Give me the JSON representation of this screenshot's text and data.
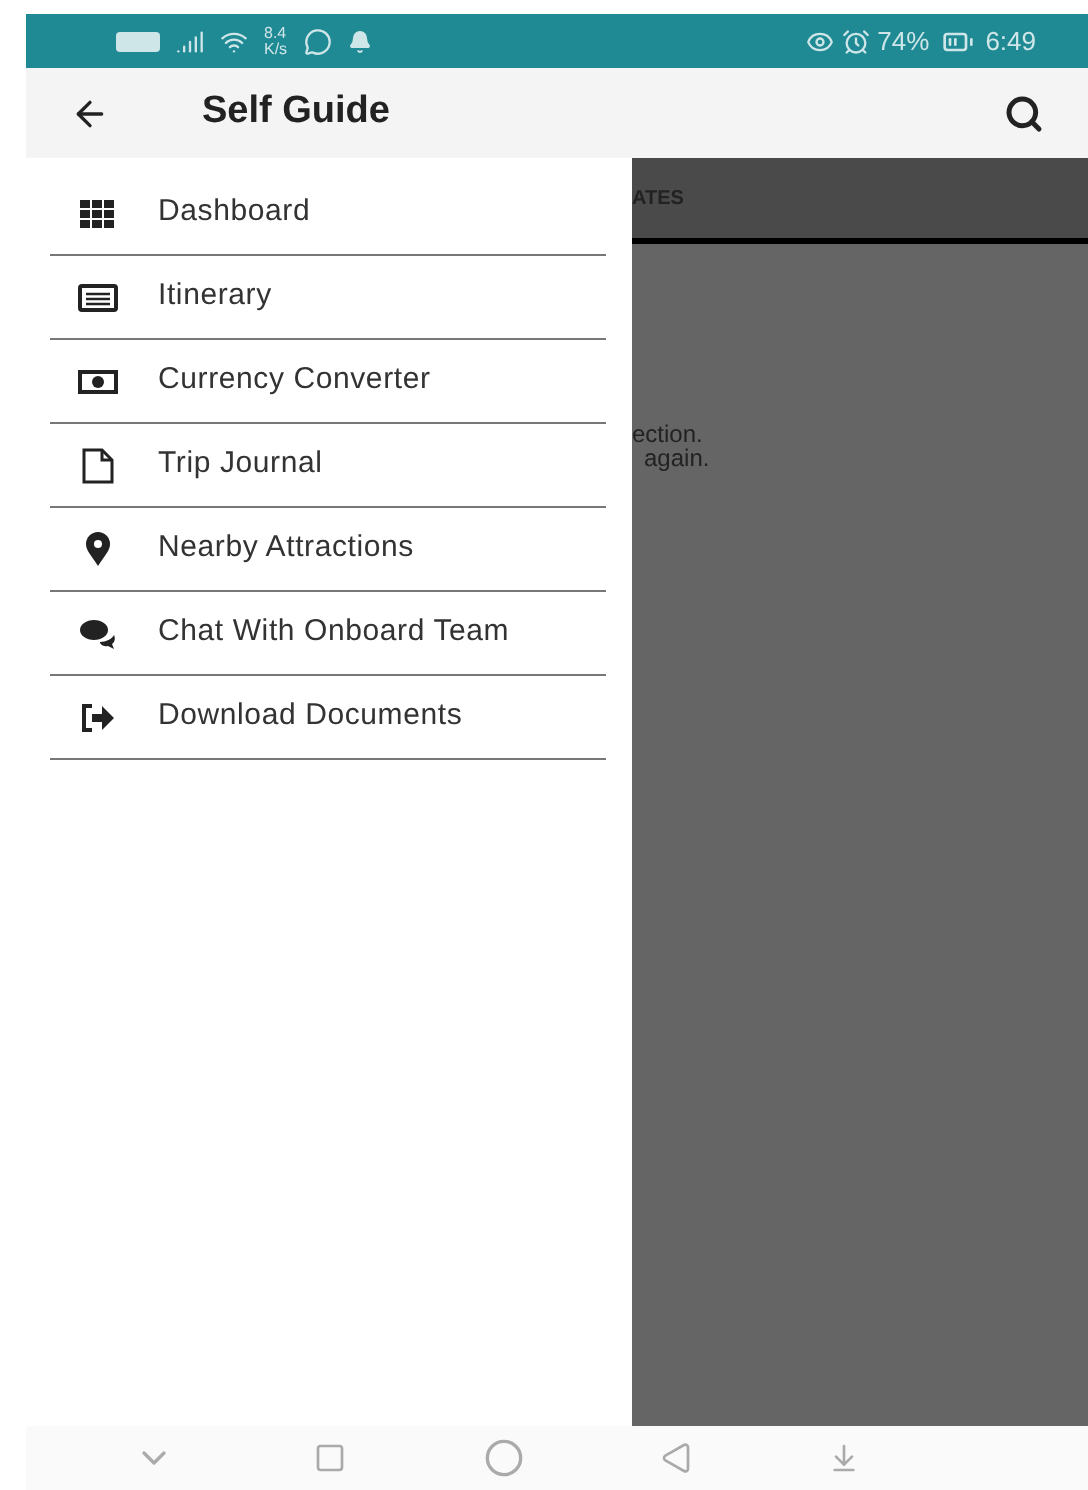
{
  "status_bar": {
    "speed": "8.4",
    "speed_unit": "K/s",
    "battery": "74%",
    "time": "6:49"
  },
  "app_bar": {
    "title": "Self Guide"
  },
  "background": {
    "tab_label": "ATES",
    "message_lines": [
      "ection.",
      "again."
    ]
  },
  "drawer": {
    "items": [
      {
        "kind": "grid",
        "label": "Dashboard"
      },
      {
        "kind": "list",
        "label": "Itinerary"
      },
      {
        "kind": "money",
        "label": "Currency Converter"
      },
      {
        "kind": "page",
        "label": "Trip Journal"
      },
      {
        "kind": "pin",
        "label": "Nearby Attractions"
      },
      {
        "kind": "chat",
        "label": "Chat With Onboard Team"
      },
      {
        "kind": "exit",
        "label": "Download Documents"
      }
    ]
  }
}
